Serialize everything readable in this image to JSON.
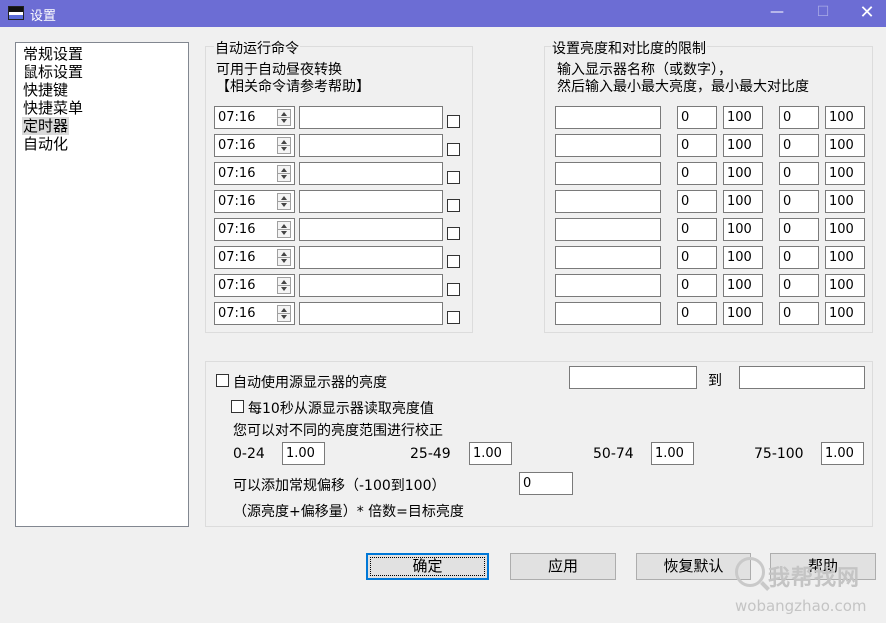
{
  "window": {
    "title": "设置",
    "min_glyph": "—",
    "max_glyph": "☐",
    "close_glyph": "✕",
    "titlebar_color": "#6c6dd4"
  },
  "nav": {
    "items": [
      "常规设置",
      "鼠标设置",
      "快捷键",
      "快捷菜单",
      "定时器",
      "自动化"
    ],
    "selected_index": 4
  },
  "auto_run": {
    "group_label": "自动运行命令",
    "desc1": "可用于自动昼夜转换",
    "desc2": "【相关命令请参考帮助】",
    "rows": [
      {
        "time": "07:16",
        "command": "",
        "checked": false
      },
      {
        "time": "07:16",
        "command": "",
        "checked": false
      },
      {
        "time": "07:16",
        "command": "",
        "checked": false
      },
      {
        "time": "07:16",
        "command": "",
        "checked": false
      },
      {
        "time": "07:16",
        "command": "",
        "checked": false
      },
      {
        "time": "07:16",
        "command": "",
        "checked": false
      },
      {
        "time": "07:16",
        "command": "",
        "checked": false
      },
      {
        "time": "07:16",
        "command": "",
        "checked": false
      }
    ]
  },
  "limits": {
    "group_label": "设置亮度和对比度的限制",
    "desc1": "输入显示器名称（或数字），",
    "desc2": "然后输入最小最大亮度，最小最大对比度",
    "rows": [
      {
        "monitor": "",
        "min_b": "0",
        "max_b": "100",
        "min_c": "0",
        "max_c": "100"
      },
      {
        "monitor": "",
        "min_b": "0",
        "max_b": "100",
        "min_c": "0",
        "max_c": "100"
      },
      {
        "monitor": "",
        "min_b": "0",
        "max_b": "100",
        "min_c": "0",
        "max_c": "100"
      },
      {
        "monitor": "",
        "min_b": "0",
        "max_b": "100",
        "min_c": "0",
        "max_c": "100"
      },
      {
        "monitor": "",
        "min_b": "0",
        "max_b": "100",
        "min_c": "0",
        "max_c": "100"
      },
      {
        "monitor": "",
        "min_b": "0",
        "max_b": "100",
        "min_c": "0",
        "max_c": "100"
      },
      {
        "monitor": "",
        "min_b": "0",
        "max_b": "100",
        "min_c": "0",
        "max_c": "100"
      },
      {
        "monitor": "",
        "min_b": "0",
        "max_b": "100",
        "min_c": "0",
        "max_c": "100"
      }
    ]
  },
  "source": {
    "use_source_label": "自动使用源显示器的亮度",
    "use_source_checked": false,
    "from_value": "",
    "to_label": "到",
    "to_value": "",
    "read_every_label": "每10秒从源显示器读取亮度值",
    "read_every_checked": false,
    "calib_label": "您可以对不同的亮度范围进行校正",
    "ranges": [
      {
        "label": "0-24",
        "value": "1.00"
      },
      {
        "label": "25-49",
        "value": "1.00"
      },
      {
        "label": "50-74",
        "value": "1.00"
      },
      {
        "label": "75-100",
        "value": "1.00"
      }
    ],
    "offset_label": "可以添加常规偏移（-100到100）",
    "offset_value": "0",
    "formula": "（源亮度+偏移量）* 倍数=目标亮度"
  },
  "buttons": {
    "ok": "确定",
    "apply": "应用",
    "restore": "恢复默认",
    "help": "帮助"
  },
  "watermark": {
    "text": "我帮找网",
    "url": "wobangzhao.com"
  }
}
